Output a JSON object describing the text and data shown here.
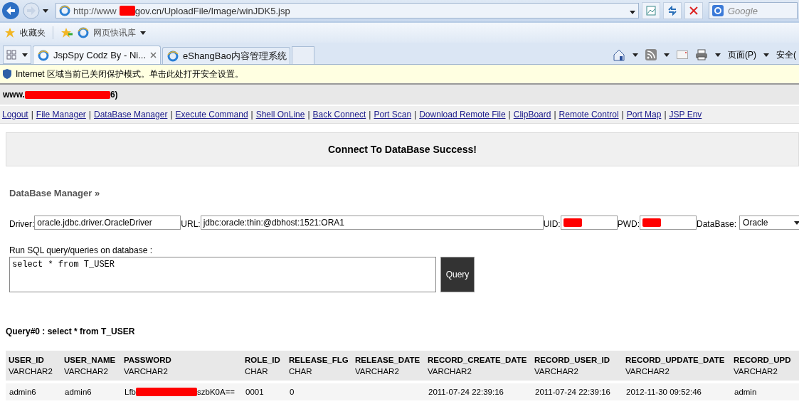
{
  "browser": {
    "address": {
      "url_before": "http://www",
      "url_after": "gov.cn/UploadFile/Image/winJDK5.jsp"
    },
    "search": {
      "placeholder": "Google"
    },
    "favorites": {
      "label": "收藏夹",
      "web_slice": "网页快讯库"
    },
    "tabs": [
      {
        "label": "JspSpy Codz By - Ni...",
        "selected": true
      },
      {
        "label": "eShangBao内容管理系统",
        "selected": false
      }
    ],
    "command_bar": [
      "页面(P)",
      "安全("
    ],
    "info_bar": "Internet 区域当前已关闭保护模式。单击此处打开安全设置。"
  },
  "page": {
    "host": {
      "before": "www.",
      "after": "6)"
    },
    "link_separator": "|",
    "nav_links": [
      "Logout",
      "File Manager",
      "DataBase Manager",
      "Execute Command",
      "Shell OnLine",
      "Back Connect",
      "Port Scan",
      "Download Remote File",
      "ClipBoard",
      "Remote Control",
      "Port Map",
      "JSP Env"
    ],
    "message": "Connect To DataBase Success!",
    "section_title": "DataBase Manager »",
    "fields": [
      {
        "kind": "text",
        "label": "Driver:",
        "value": "oracle.jdbc.driver.OracleDriver"
      },
      {
        "kind": "wide",
        "label": "URL:",
        "value": "jdbc:oracle:thin:@dbhost:1521:ORA1"
      },
      {
        "kind": "redacted",
        "label": "UID:"
      },
      {
        "kind": "redacted",
        "label": "PWD:"
      },
      {
        "kind": "select",
        "label": "DataBase:",
        "value": "Oracle"
      }
    ],
    "sql_label": "Run SQL query/queries on database :",
    "sql_value": "select * from T_USER",
    "query_button": "Query",
    "query_title": "Query#0 : select * from T_USER",
    "table": {
      "columns": [
        {
          "name": "USER_ID",
          "type": "VARCHAR2"
        },
        {
          "name": "USER_NAME",
          "type": "VARCHAR2"
        },
        {
          "name": "PASSWORD",
          "type": "VARCHAR2"
        },
        {
          "name": "ROLE_ID",
          "type": "CHAR"
        },
        {
          "name": "RELEASE_FLG",
          "type": "CHAR"
        },
        {
          "name": "RELEASE_DATE",
          "type": "VARCHAR2"
        },
        {
          "name": "RECORD_CREATE_DATE",
          "type": "VARCHAR2"
        },
        {
          "name": "RECORD_USER_ID",
          "type": "VARCHAR2"
        },
        {
          "name": "RECORD_UPDATE_DATE",
          "type": "VARCHAR2"
        },
        {
          "name": "RECORD_UPD",
          "type": "VARCHAR2"
        }
      ],
      "rows": [
        [
          {
            "kind": "text",
            "text": "admin6"
          },
          {
            "kind": "text",
            "text": "admin6"
          },
          {
            "kind": "redacted",
            "before": "Lfb",
            "after": "szbK0A=="
          },
          {
            "kind": "text",
            "text": "0001"
          },
          {
            "kind": "text",
            "text": "0"
          },
          {
            "kind": "empty"
          },
          {
            "kind": "text",
            "text": "2011-07-24 22:39:16"
          },
          {
            "kind": "text",
            "text": "2011-07-24 22:39:16"
          },
          {
            "kind": "text",
            "text": "2012-11-30 09:52:46"
          },
          {
            "kind": "text",
            "text": "admin"
          }
        ]
      ]
    }
  }
}
